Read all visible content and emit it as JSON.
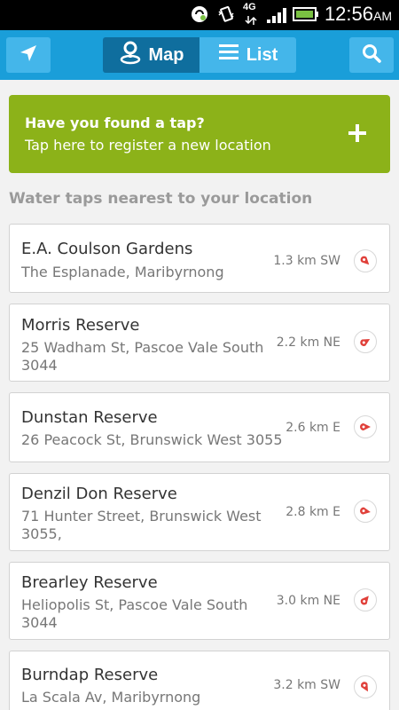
{
  "status": {
    "network": "4G",
    "time": "12:56",
    "ampm": "AM"
  },
  "appbar": {
    "locate_icon": "location-arrow-icon",
    "map_label": "Map",
    "list_label": "List",
    "search_icon": "search-icon"
  },
  "add_tap": {
    "title": "Have you found a tap?",
    "subtitle": "Tap here to register a new location",
    "icon": "plus-icon"
  },
  "section_title": "Water taps nearest to your location",
  "taps": [
    {
      "name": "E.A. Coulson Gardens",
      "address": "The Esplanade, Maribyrnong",
      "distance": "1.3 km SW",
      "direction": "SW"
    },
    {
      "name": "Morris Reserve",
      "address": "25 Wadham St,  Pascoe Vale South 3044",
      "distance": "2.2 km NE",
      "direction": "NE"
    },
    {
      "name": "Dunstan Reserve",
      "address": "26 Peacock St,  Brunswick West 3055",
      "distance": "2.6 km E",
      "direction": "E"
    },
    {
      "name": "Denzil Don Reserve",
      "address": "71 Hunter Street,  Brunswick West 3055,",
      "distance": "2.8 km E",
      "direction": "E"
    },
    {
      "name": "Brearley Reserve",
      "address": "Heliopolis St,  Pascoe Vale South 3044",
      "distance": "3.0 km NE",
      "direction": "NE"
    },
    {
      "name": "Burndap Reserve",
      "address": "La Scala Av, Maribyrnong",
      "distance": "3.2 km SW",
      "direction": "SW"
    }
  ],
  "colors": {
    "appbar": "#1a9ed9",
    "accent_button": "#44b6ea",
    "active_tab": "#0f6e9e",
    "add_card": "#8cb219",
    "pointer": "#e0403a"
  }
}
